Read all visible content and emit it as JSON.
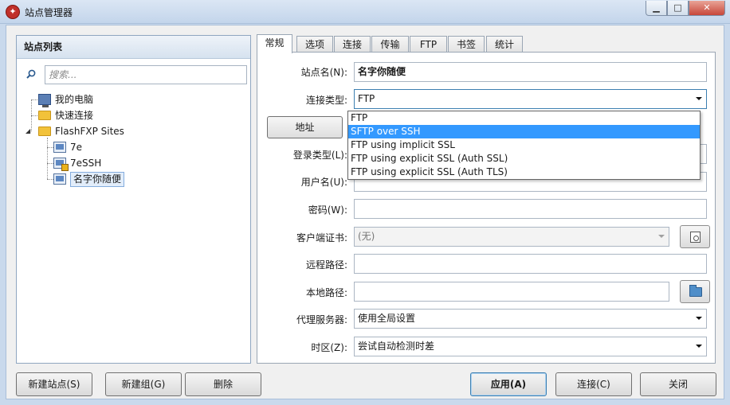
{
  "window": {
    "title": "站点管理器",
    "buttons": {
      "minimize": "▁",
      "maximize": "□",
      "close": "✕"
    }
  },
  "site_panel": {
    "header": "站点列表",
    "search_placeholder": "搜索...",
    "tree": [
      {
        "label": "我的电脑",
        "icon": "computer-icon"
      },
      {
        "label": "快速连接",
        "icon": "folder-icon"
      },
      {
        "label": "FlashFXP Sites",
        "icon": "folder-icon",
        "expanded": true
      },
      {
        "label": "7e",
        "icon": "monitor-icon"
      },
      {
        "label": "7eSSH",
        "icon": "monitor-lock-icon"
      },
      {
        "label": "名字你随便",
        "icon": "monitor-icon",
        "selected": true
      }
    ]
  },
  "tabs": [
    "常规",
    "选项",
    "连接",
    "传输",
    "FTP",
    "书签",
    "统计"
  ],
  "active_tab": "常规",
  "form": {
    "site_name": {
      "label": "站点名(N):",
      "value": "名字你随便"
    },
    "conn_type": {
      "label": "连接类型:",
      "value": "FTP"
    },
    "address_button": "地址",
    "login_type": {
      "label": "登录类型(L):"
    },
    "username": {
      "label": "用户名(U):",
      "value": ""
    },
    "password": {
      "label": "密码(W):",
      "value": ""
    },
    "client_cert": {
      "label": "客户端证书:",
      "value": "(无)"
    },
    "remote_path": {
      "label": "远程路径:",
      "value": ""
    },
    "local_path": {
      "label": "本地路径:",
      "value": ""
    },
    "proxy": {
      "label": "代理服务器:",
      "value": "使用全局设置"
    },
    "timezone": {
      "label": "时区(Z):",
      "value": "尝试自动检测时差"
    }
  },
  "conn_type_dropdown": {
    "options": [
      "FTP",
      "SFTP over SSH",
      "FTP using implicit SSL",
      "FTP using explicit SSL (Auth SSL)",
      "FTP using explicit SSL (Auth TLS)"
    ],
    "highlighted": "SFTP over SSH"
  },
  "bottom_buttons": {
    "new_site": "新建站点(S)",
    "new_group": "新建组(G)",
    "delete": "删除",
    "apply": "应用(A)",
    "connect": "连接(C)",
    "close": "关闭"
  }
}
